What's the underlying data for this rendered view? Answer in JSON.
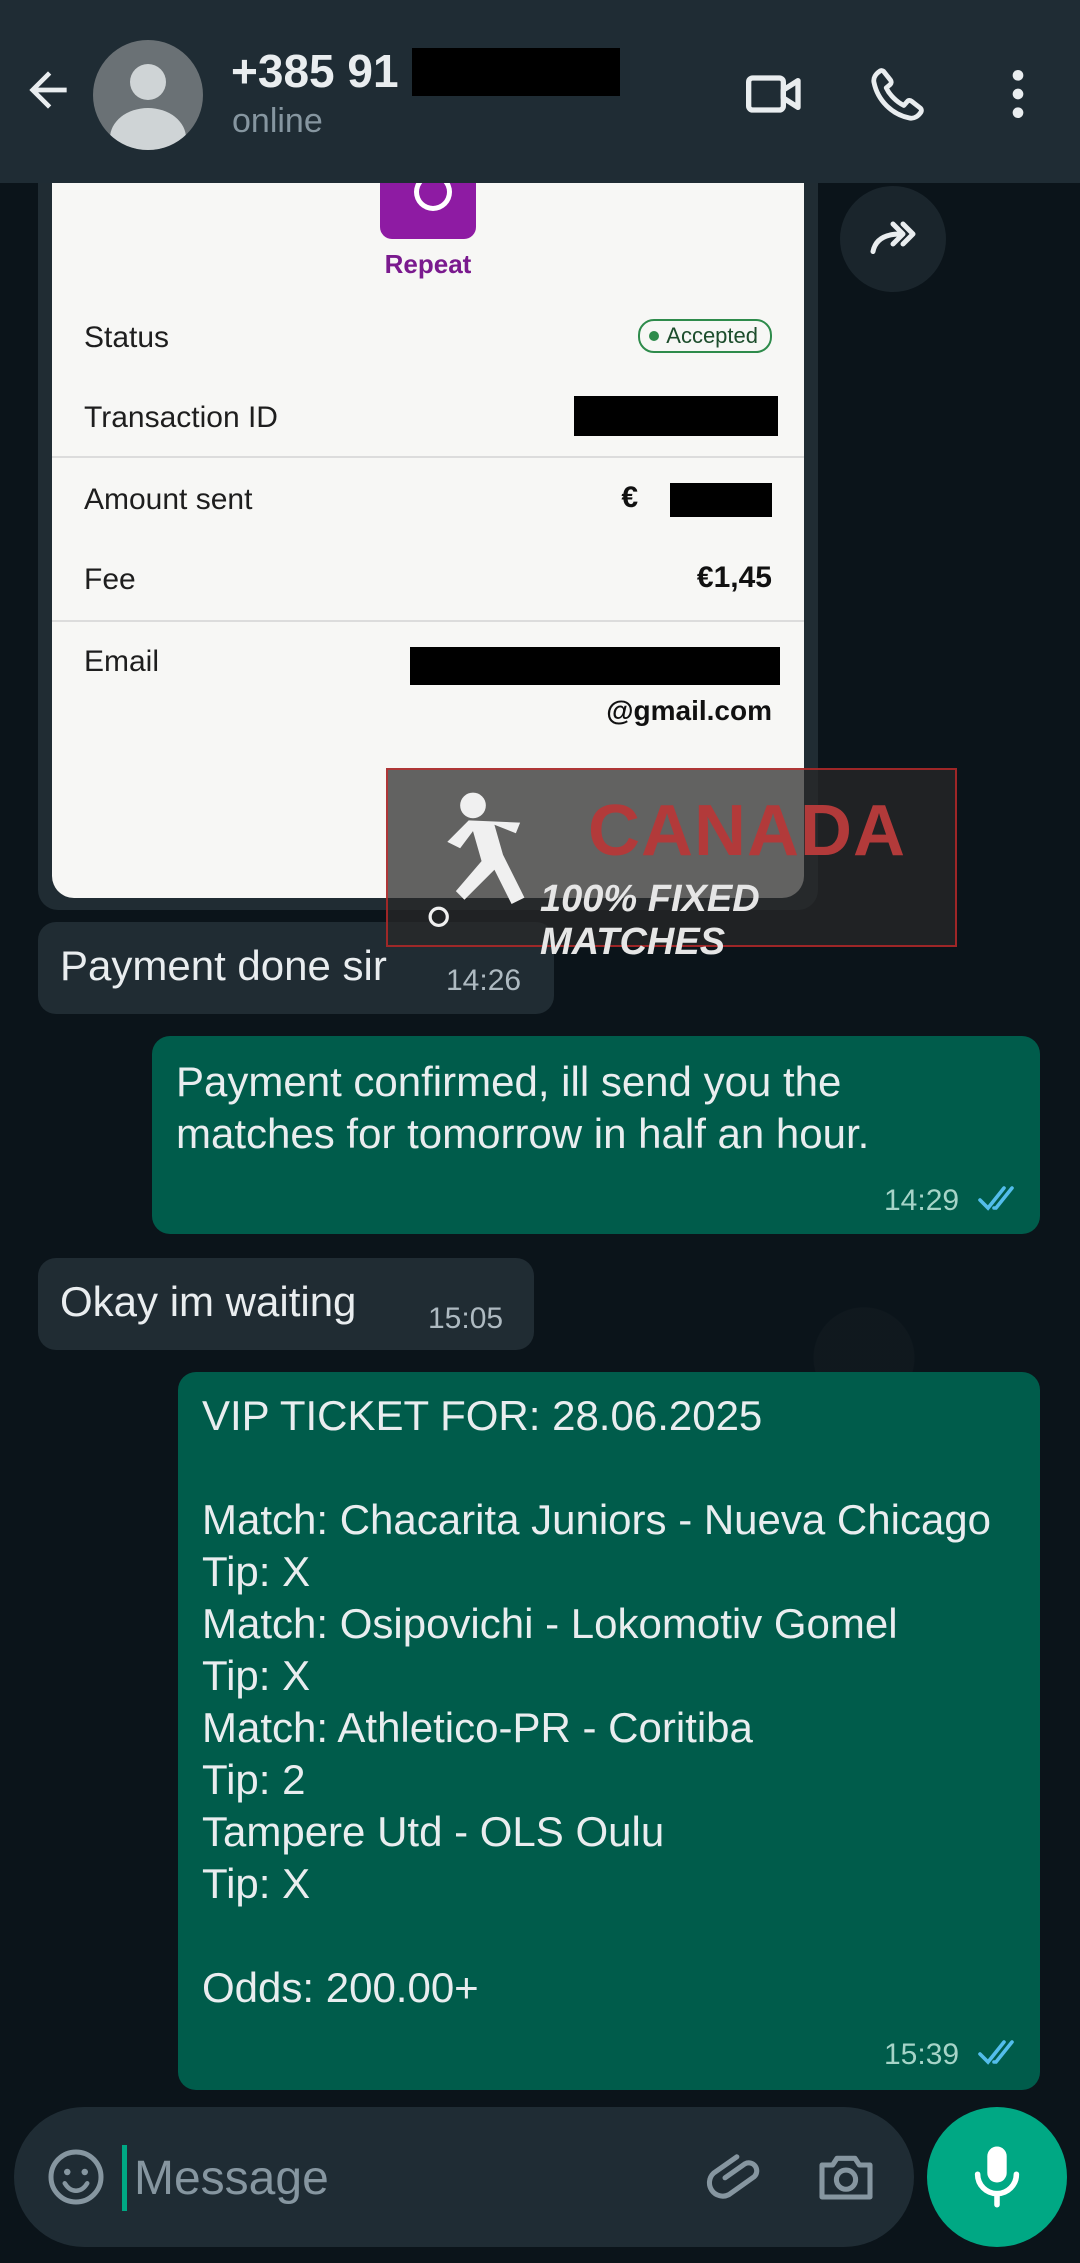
{
  "header": {
    "contact_name": "+385 91",
    "status": "online",
    "icons": [
      "back-arrow-icon",
      "video-call-icon",
      "phone-icon",
      "more-vert-icon"
    ]
  },
  "receipt": {
    "repeat_label": "Repeat",
    "status_label": "Status",
    "status_value": "Accepted",
    "transaction_label": "Transaction ID",
    "amount_label": "Amount sent",
    "amount_prefix": "€",
    "fee_label": "Fee",
    "fee_value": "€1,45",
    "email_label": "Email",
    "email_suffix": "@gmail.com"
  },
  "watermark": {
    "title": "CANADA",
    "subtitle": "100% FIXED MATCHES"
  },
  "messages": [
    {
      "direction": "in",
      "text": "Payment done sir",
      "time": "14:26"
    },
    {
      "direction": "out",
      "text": "Payment confirmed, ill send you the\nmatches for tomorrow in half an hour.",
      "time": "14:29",
      "read": true
    },
    {
      "direction": "in",
      "text": "Okay im waiting",
      "time": "15:05"
    },
    {
      "direction": "out",
      "text": "VIP TICKET FOR: 28.06.2025\n\nMatch: Chacarita Juniors - Nueva Chicago\nTip: X\nMatch: Osipovichi - Lokomotiv Gomel\nTip: X\nMatch: Athletico-PR - Coritiba\nTip: 2\nTampere Utd - OLS Oulu\nTip: X\n\nOdds: 200.00+",
      "time": "15:39",
      "read": true
    }
  ],
  "composer": {
    "placeholder": "Message"
  },
  "colors": {
    "header": "#1f2c34",
    "incoming": "#202c33",
    "outgoing": "#005c4b",
    "accent": "#00a884",
    "read_tick": "#53bdeb"
  }
}
